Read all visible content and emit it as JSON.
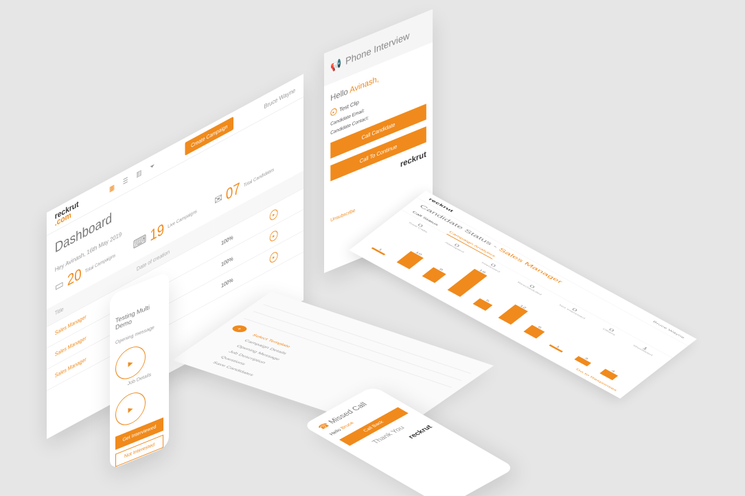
{
  "dashboard": {
    "logo_top": "reckrut",
    "logo_bottom": ".com",
    "title": "Dashboard",
    "subtitle": "Hey Avinash, 16th May 2019",
    "create_button": "Create Campaign",
    "stats": [
      {
        "num": "20",
        "label": "Total Campaigns"
      },
      {
        "num": "19",
        "label": "Live Campaigns"
      },
      {
        "num": "07",
        "label": "Total Candidates"
      }
    ],
    "table_header": [
      "Title",
      "Date of creation"
    ],
    "rows": [
      {
        "title": "Sales Manager",
        "pct": "100%"
      },
      {
        "title": "Sales Manager",
        "pct": "100%"
      },
      {
        "title": "Sales Manager",
        "pct": "100%"
      }
    ],
    "user": "Bruce Wayne"
  },
  "phone_interview": {
    "title": "Phone Interview",
    "hello": "Hello",
    "name": "Avinash,",
    "clip": "Test Clip",
    "cand_email_label": "Candidate Email:",
    "cand_contact_label": "Candidate Contact:",
    "btn_text": "Call Candidate",
    "btn_dark": "Call To Continue",
    "logo": "reckrut",
    "unsubscribe": "Unsubscribe"
  },
  "candidate": {
    "title": "Candidate Status -",
    "role": "Sales Manager",
    "tabs": [
      "Call Status",
      "Campaign Analytics"
    ],
    "counts": [
      {
        "n": "0",
        "l": "Total Calls"
      },
      {
        "n": "0",
        "l": "Attempted"
      },
      {
        "n": "0",
        "l": "Interested"
      },
      {
        "n": "0",
        "l": "Rescheduled"
      },
      {
        "n": "0",
        "l": "Not Interested"
      },
      {
        "n": "0",
        "l": "Others"
      },
      {
        "n": "1",
        "l": "Shortlisted"
      }
    ],
    "link": "Go to Responses",
    "user": "Bruce Wayne"
  },
  "chart_data": {
    "type": "bar",
    "values": [
      1,
      10,
      8,
      19,
      5,
      12,
      6,
      1,
      3,
      4
    ]
  },
  "flow": {
    "items": [
      "Campaign Details",
      "Opening Message",
      "Job Description",
      "Questions",
      "Save Candidates"
    ],
    "select_label": "Select Template"
  },
  "mobile_left": {
    "title": "Testing Multi Demo",
    "question": "Opening message",
    "second": "Job Details",
    "btn1": "Get Interviewed",
    "btn2": "Not Interested"
  },
  "mobile_bottom": {
    "title": "Missed Call",
    "greeting": "Hello",
    "name": "Bruce",
    "btn": "Call Back",
    "thanks": "Thank You",
    "logo": "reckrut"
  },
  "colors": {
    "accent": "#f08a1c",
    "blue": "#3aa0e0",
    "grey": "#b5b5b5"
  }
}
